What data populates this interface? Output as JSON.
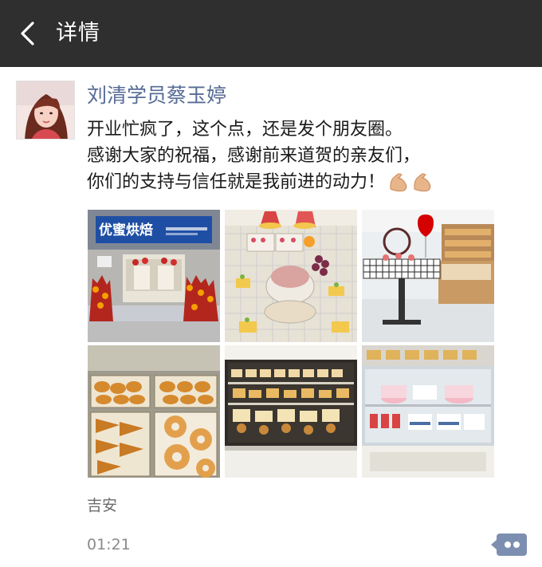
{
  "header": {
    "title": "详情",
    "back_icon": "chevron-left-icon"
  },
  "post": {
    "author": "刘清学员蔡玉婷",
    "lines": [
      "开业忙疯了，这个点，还是发个朋友圈。",
      "感谢大家的祝福，感谢前来道贺的亲友们，",
      "你们的支持与信任就是我前进的动力！"
    ],
    "emoji": "flexed-biceps-icon",
    "store_sign": "优蜜烘焙",
    "photo_count": 6,
    "location": "吉安",
    "time": "01:21",
    "comment_icon": "comment-more-icon"
  },
  "colors": {
    "header_bg": "#2f2f2f",
    "author_link": "#576b95",
    "comment_button": "#7d8fb0"
  }
}
